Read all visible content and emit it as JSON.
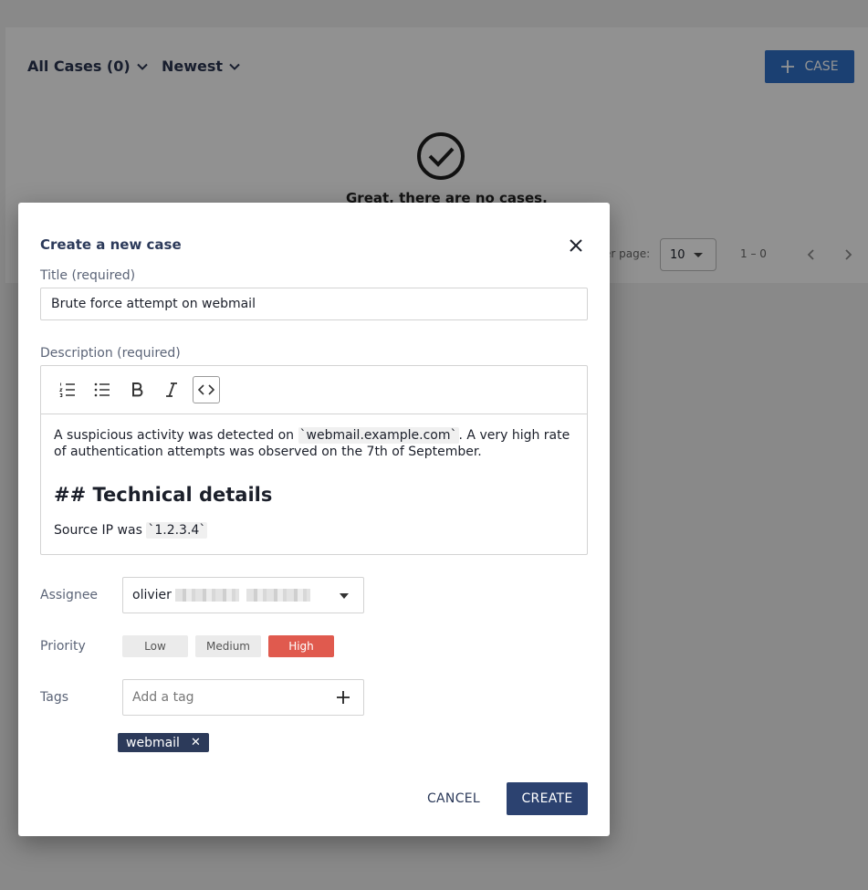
{
  "background": {
    "filters": {
      "cases_label": "All Cases (0)",
      "sort_label": "Newest"
    },
    "add_case_label": "CASE",
    "empty_message": "Great, there are no cases.",
    "pagination": {
      "per_page_label": "er page:",
      "per_page_value": "10",
      "range": "1 – 0"
    }
  },
  "dialog": {
    "title": "Create a new case",
    "title_label": "Title (required)",
    "title_value": "Brute force attempt on webmail",
    "description_label": "Description (required)",
    "toolbar": [
      "numbered-list-icon",
      "bulleted-list-icon",
      "bold-icon",
      "italic-icon",
      "code-icon"
    ],
    "description": {
      "p1_a": "A suspicious activity was detected on ",
      "p1_code": "`webmail.example.com`",
      "p1_b": ". A very high rate of authentication attempts was observed on the 7th of September.",
      "heading": "## Technical details",
      "p2_a": "Source IP was ",
      "p2_code": "`1.2.3.4`"
    },
    "assignee_label": "Assignee",
    "assignee_value": "olivier",
    "priority_label": "Priority",
    "priorities": [
      "Low",
      "Medium",
      "High"
    ],
    "selected_priority": "High",
    "tags_label": "Tags",
    "tag_placeholder": "Add a tag",
    "tags": [
      "webmail"
    ],
    "cancel_label": "CANCEL",
    "create_label": "CREATE",
    "colors": {
      "primary": "#2c4270",
      "high_priority": "#e05a4e",
      "accent_blue": "#2f6fc4"
    }
  }
}
